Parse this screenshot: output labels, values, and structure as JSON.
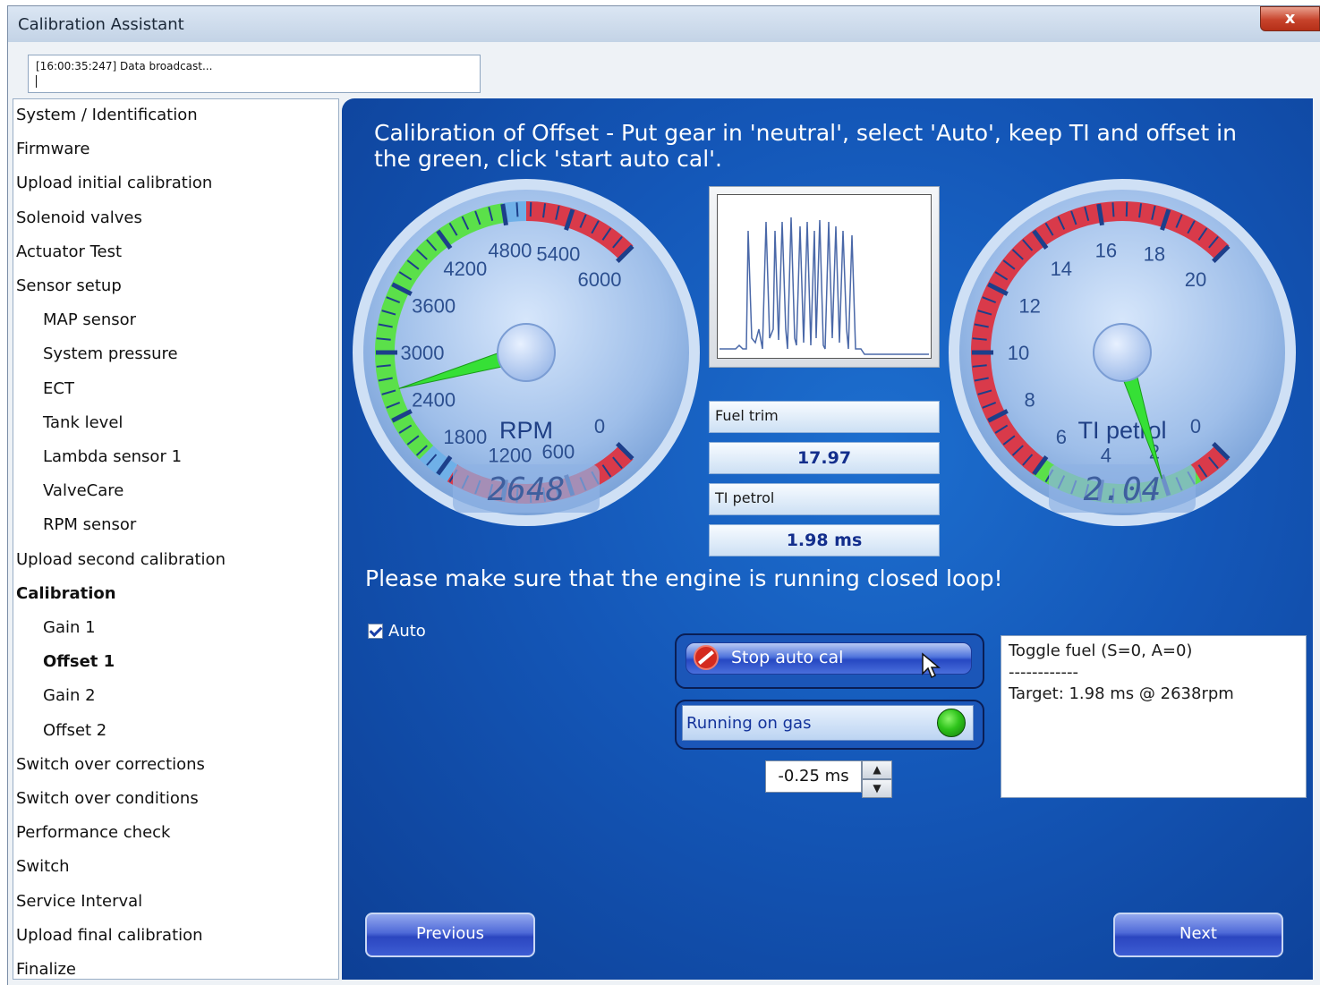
{
  "window": {
    "title": "Calibration Assistant",
    "close_glyph": "x"
  },
  "log": {
    "line": "[16:00:35:247] Data broadcast..."
  },
  "sidebar": {
    "items": [
      {
        "label": "System / Identification",
        "level": 0,
        "bold": false
      },
      {
        "label": "Firmware",
        "level": 0,
        "bold": false
      },
      {
        "label": "Upload initial calibration",
        "level": 0,
        "bold": false
      },
      {
        "label": "Solenoid valves",
        "level": 0,
        "bold": false
      },
      {
        "label": "Actuator Test",
        "level": 0,
        "bold": false
      },
      {
        "label": "Sensor setup",
        "level": 0,
        "bold": false
      },
      {
        "label": "MAP sensor",
        "level": 1,
        "bold": false
      },
      {
        "label": "System pressure",
        "level": 1,
        "bold": false
      },
      {
        "label": "ECT",
        "level": 1,
        "bold": false
      },
      {
        "label": "Tank level",
        "level": 1,
        "bold": false
      },
      {
        "label": "Lambda sensor 1",
        "level": 1,
        "bold": false
      },
      {
        "label": "ValveCare",
        "level": 1,
        "bold": false
      },
      {
        "label": "RPM sensor",
        "level": 1,
        "bold": false
      },
      {
        "label": "Upload second calibration",
        "level": 0,
        "bold": false
      },
      {
        "label": "Calibration",
        "level": 0,
        "bold": true
      },
      {
        "label": "Gain 1",
        "level": 1,
        "bold": false
      },
      {
        "label": "Offset 1",
        "level": 1,
        "bold": true
      },
      {
        "label": "Gain 2",
        "level": 1,
        "bold": false
      },
      {
        "label": "Offset 2",
        "level": 1,
        "bold": false
      },
      {
        "label": "Switch over corrections",
        "level": 0,
        "bold": false
      },
      {
        "label": "Switch over conditions",
        "level": 0,
        "bold": false
      },
      {
        "label": "Performance check",
        "level": 0,
        "bold": false
      },
      {
        "label": "Switch",
        "level": 0,
        "bold": false
      },
      {
        "label": "Service Interval",
        "level": 0,
        "bold": false
      },
      {
        "label": "Upload final calibration",
        "level": 0,
        "bold": false
      },
      {
        "label": "Finalize",
        "level": 0,
        "bold": false
      }
    ]
  },
  "main": {
    "instruction": "Calibration of Offset - Put gear in 'neutral', select 'Auto', keep TI and offset in the green, click 'start auto cal'.",
    "warning": "Please make sure that the engine is running closed loop!"
  },
  "rpm_gauge": {
    "label": "RPM",
    "readout": "2648",
    "value": 2648,
    "ticks": [
      "0",
      "600",
      "1200",
      "1800",
      "2400",
      "3000",
      "3600",
      "4200",
      "4800",
      "5400",
      "6000"
    ]
  },
  "ti_gauge": {
    "label": "TI petrol",
    "readout": "2.04",
    "value": 2.04,
    "ticks": [
      "0",
      "2",
      "4",
      "6",
      "8",
      "10",
      "12",
      "14",
      "16",
      "18",
      "20"
    ]
  },
  "info": {
    "fuel_trim_label": "Fuel trim",
    "fuel_trim_value": "17.97",
    "ti_petrol_label": "TI petrol",
    "ti_petrol_value": "1.98 ms"
  },
  "controls": {
    "auto_label": "Auto",
    "auto_checked": true,
    "stop_label": "Stop auto cal",
    "gas_label": "Running on gas",
    "offset_value": "-0.25 ms",
    "spin_up_glyph": "▲",
    "spin_down_glyph": "▼"
  },
  "status": {
    "line1": "Toggle fuel (S=0, A=0)",
    "line2": "------------",
    "line3": "Target: 1.98 ms @ 2638rpm"
  },
  "nav": {
    "previous_label": "Previous",
    "next_label": "Next"
  },
  "colors": {
    "panel_blue": "#1457b8",
    "green_zone": "#5be04a",
    "red_zone": "#d93a4a",
    "needle": "#36e036",
    "led_green": "#2ec41b"
  }
}
